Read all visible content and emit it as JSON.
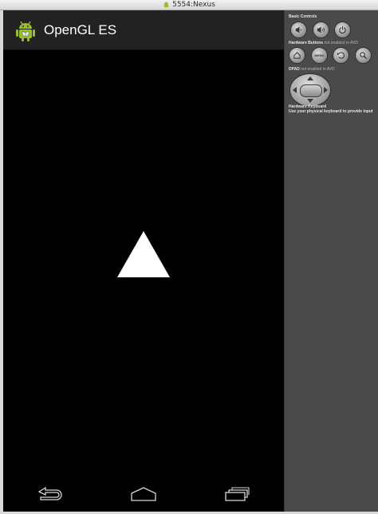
{
  "window": {
    "title": "5554:Nexus"
  },
  "app": {
    "title": "OpenGL ES",
    "icon": "android-robot-icon"
  },
  "scene": {
    "shape": "white-triangle",
    "color": "#ffffff",
    "background": "#000000"
  },
  "navbar": {
    "buttons": [
      {
        "name": "back",
        "icon": "back-arrow-icon"
      },
      {
        "name": "home",
        "icon": "home-icon"
      },
      {
        "name": "recents",
        "icon": "recent-apps-icon"
      }
    ]
  },
  "controls": {
    "basic_label": "Basic Controls",
    "basic_buttons": [
      "volume-down-icon",
      "volume-up-icon",
      "power-icon"
    ],
    "hardware_label": "Hardware Buttons",
    "hardware_note": "not enabled in AVD",
    "hardware_buttons": [
      "home-icon",
      "menu-icon",
      "back-icon",
      "search-icon"
    ],
    "menu_text": "MENU",
    "dpad_label": "DPAD",
    "dpad_note": "not enabled in AVD",
    "keyboard_label": "Hardware Keyboard",
    "keyboard_note": "Use your physical keyboard to provide input"
  },
  "colors": {
    "actionbar": "#222222",
    "panel": "#4a4a4a",
    "android_green": "#97c024"
  }
}
